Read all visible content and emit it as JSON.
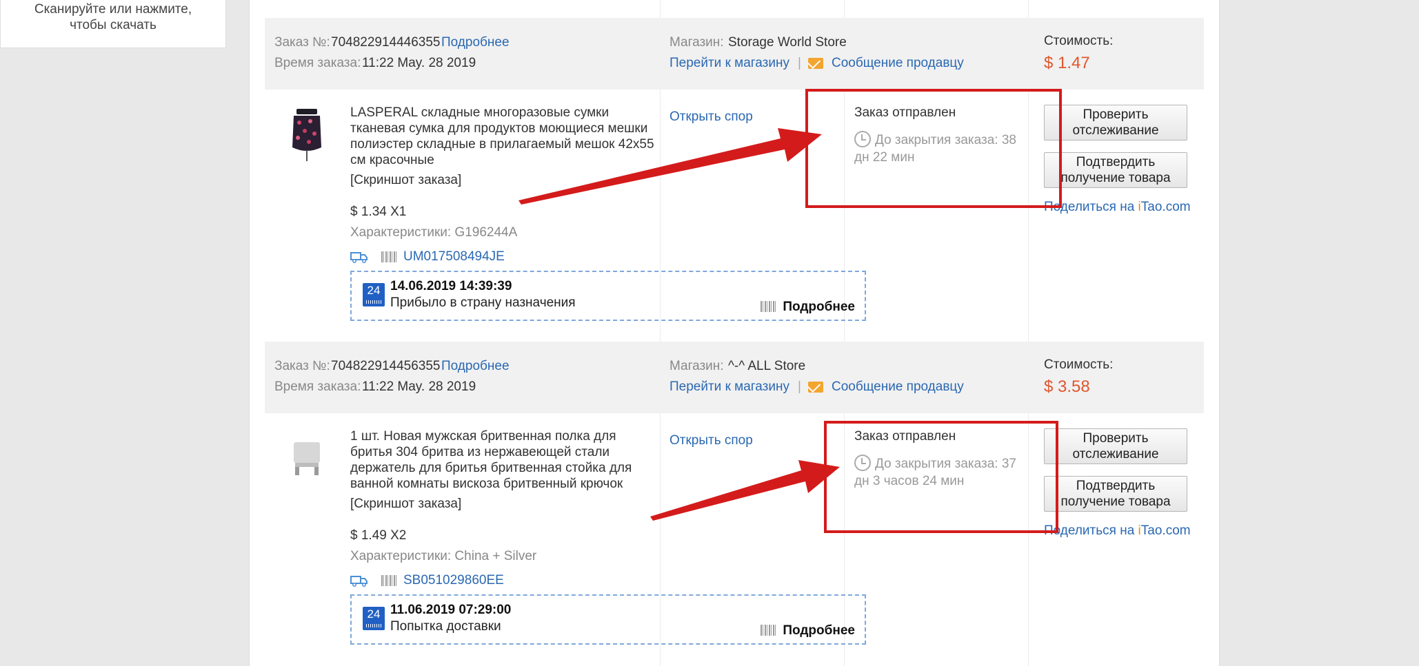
{
  "sidebar": {
    "line1": "Сканируйте или нажмите,",
    "line2": "чтобы скачать"
  },
  "labels": {
    "order_no": "Заказ №:",
    "order_time": "Время заказа:",
    "details": "Подробнее",
    "store": "Магазин:",
    "go_to_store": "Перейти к магазину",
    "separator": "|",
    "message_seller": "Сообщение продавцу",
    "cost": "Стоимость:",
    "open_dispute": "Открыть спор",
    "screenshot": "[Скриншот заказа]",
    "track_btn_l1": "Проверить",
    "track_btn_l2": "отслеживание",
    "confirm_btn_l1": "Подтвердить",
    "confirm_btn_l2": "получение товара",
    "share_prefix": "Поделиться на ",
    "share_i": "i",
    "share_tao": "Tao",
    "share_com": ".com",
    "tracking_more": "Подробнее",
    "badge": "24"
  },
  "orders": [
    {
      "number": "704822914446355",
      "time": "11:22 May. 28 2019",
      "store": "Storage World Store",
      "price": "$ 1.47",
      "title": "LASPERAL складные многоразовые сумки тканевая сумка для продуктов моющиеся мешки полиэстер складные в прилагаемый мешок 42x55 см красочные",
      "unit": "$ 1.34 X1",
      "specs": "Характеристики: G196244A",
      "tracking_no": "UM017508494JE",
      "status": "Заказ отправлен",
      "countdown": "До закрытия заказа: 38 дн 22 мин",
      "track_date": "14.06.2019 14:39:39",
      "track_text": "Прибыло в страну назначения"
    },
    {
      "number": "704822914456355",
      "time": "11:22 May. 28 2019",
      "store": "^-^ ALL Store",
      "price": "$ 3.58",
      "title": "1 шт. Новая мужская бритвенная полка для бритья 304 бритва из нержавеющей стали держатель для бритья бритвенная стойка для ванной комнаты вискоза бритвенный крючок",
      "unit": "$ 1.49 X2",
      "specs": "Характеристики: China + Silver",
      "tracking_no": "SB051029860EE",
      "status": "Заказ отправлен",
      "countdown": "До закрытия заказа: 37 дн 3 часов 24 мин",
      "track_date": "11.06.2019 07:29:00",
      "track_text": "Попытка доставки"
    }
  ],
  "colors": {
    "link": "#2a68b2",
    "price": "#e0562d",
    "annotation": "#d41b1b",
    "header_bg": "#f1f1f1"
  }
}
